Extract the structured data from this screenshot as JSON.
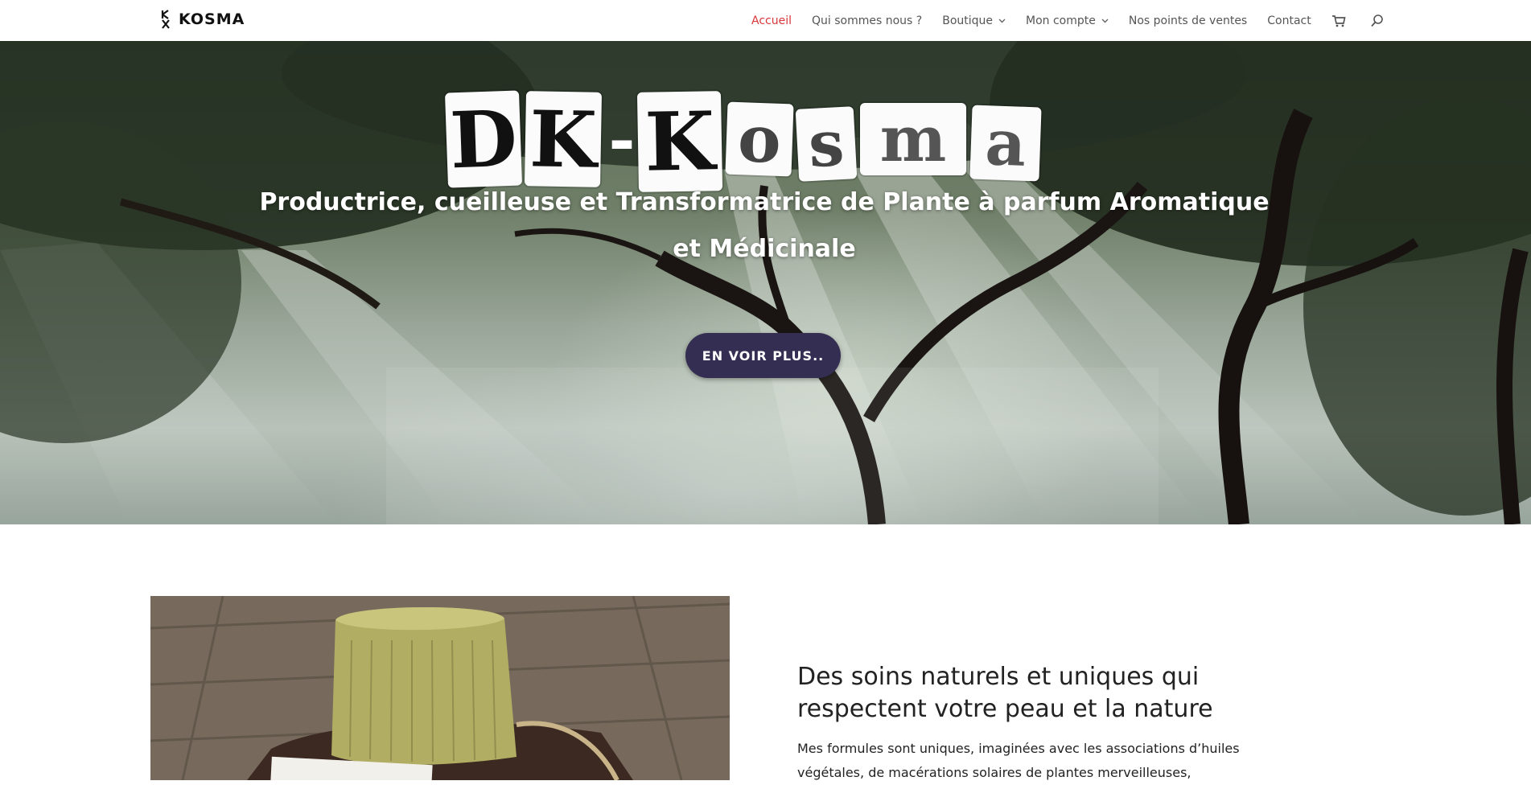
{
  "header": {
    "logo_text": "KOSMA",
    "nav": [
      {
        "label": "Accueil",
        "active": true,
        "has_dropdown": false
      },
      {
        "label": "Qui sommes nous ?",
        "active": false,
        "has_dropdown": false
      },
      {
        "label": "Boutique",
        "active": false,
        "has_dropdown": true
      },
      {
        "label": "Mon compte",
        "active": false,
        "has_dropdown": true
      },
      {
        "label": "Nos points de ventes",
        "active": false,
        "has_dropdown": false
      },
      {
        "label": "Contact",
        "active": false,
        "has_dropdown": false
      }
    ],
    "icons": [
      "cart-icon",
      "search-icon"
    ],
    "active_color": "#d8363a"
  },
  "hero": {
    "brand_title_letters": [
      "D",
      "K",
      "-",
      "K",
      "o",
      "s",
      "m",
      "a"
    ],
    "subtitle": "Productrice, cueilleuse et Transformatrice de Plante à parfum Aromatique et Médicinale",
    "button_label": "EN VOIR PLUS..",
    "button_color": "#342e52"
  },
  "product": {
    "heading": "Des soins naturels et uniques qui respectent votre peau et la nature",
    "text": "Mes formules sont uniques, imaginées avec les associations d’huiles végétales, de macérations solaires de plantes merveilleuses,"
  }
}
